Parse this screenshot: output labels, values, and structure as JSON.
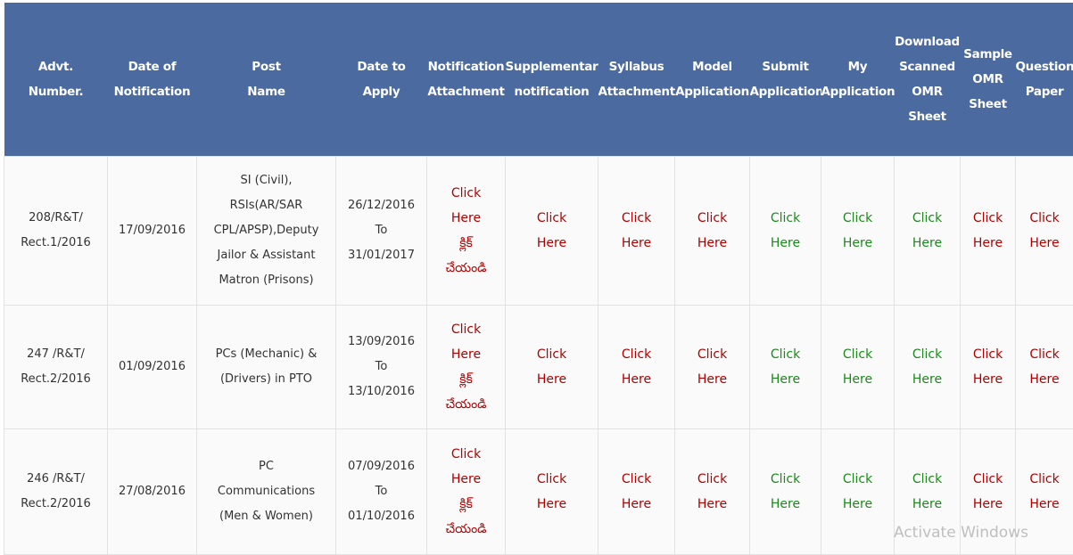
{
  "headers": [
    "Advt.\nNumber.",
    "Date of\nNotification",
    "Post\nName",
    "Date to\nApply",
    "Notification\nAttachment",
    "Supplementary\nnotification",
    "Syllabus\nAttachment",
    "Model\nApplication",
    "Submit\nApplication",
    "My\nApplication",
    "Download\nScanned\nOMR\nSheet",
    "Sample\nOMR\nSheet",
    "Question\nPaper"
  ],
  "link_text": {
    "click_here": "Click\nHere",
    "notification": "Click\nHere\nక్లిక్\nచేయండి"
  },
  "colors": {
    "header_bg": "#4a6aa0",
    "link_red": "#b00000",
    "link_green": "#1a8a1a"
  },
  "rows": [
    {
      "advt": "208/R&T/\nRect.1/2016",
      "date_notification": "17/09/2016",
      "post": "SI (Civil),\nRSIs(AR/SAR\nCPL/APSP),Deputy\nJailor & Assistant\nMatron (Prisons)",
      "date_apply": "26/12/2016\nTo\n31/01/2017"
    },
    {
      "advt": "247 /R&T/\nRect.2/2016",
      "date_notification": "01/09/2016",
      "post": "PCs (Mechanic) &\n(Drivers) in PTO",
      "date_apply": "13/09/2016\nTo\n13/10/2016"
    },
    {
      "advt": "246 /R&T/\nRect.2/2016",
      "date_notification": "27/08/2016",
      "post": "PC\nCommunications\n(Men & Women)",
      "date_apply": "07/09/2016\nTo\n01/10/2016"
    }
  ],
  "watermark": "Activate Windows"
}
